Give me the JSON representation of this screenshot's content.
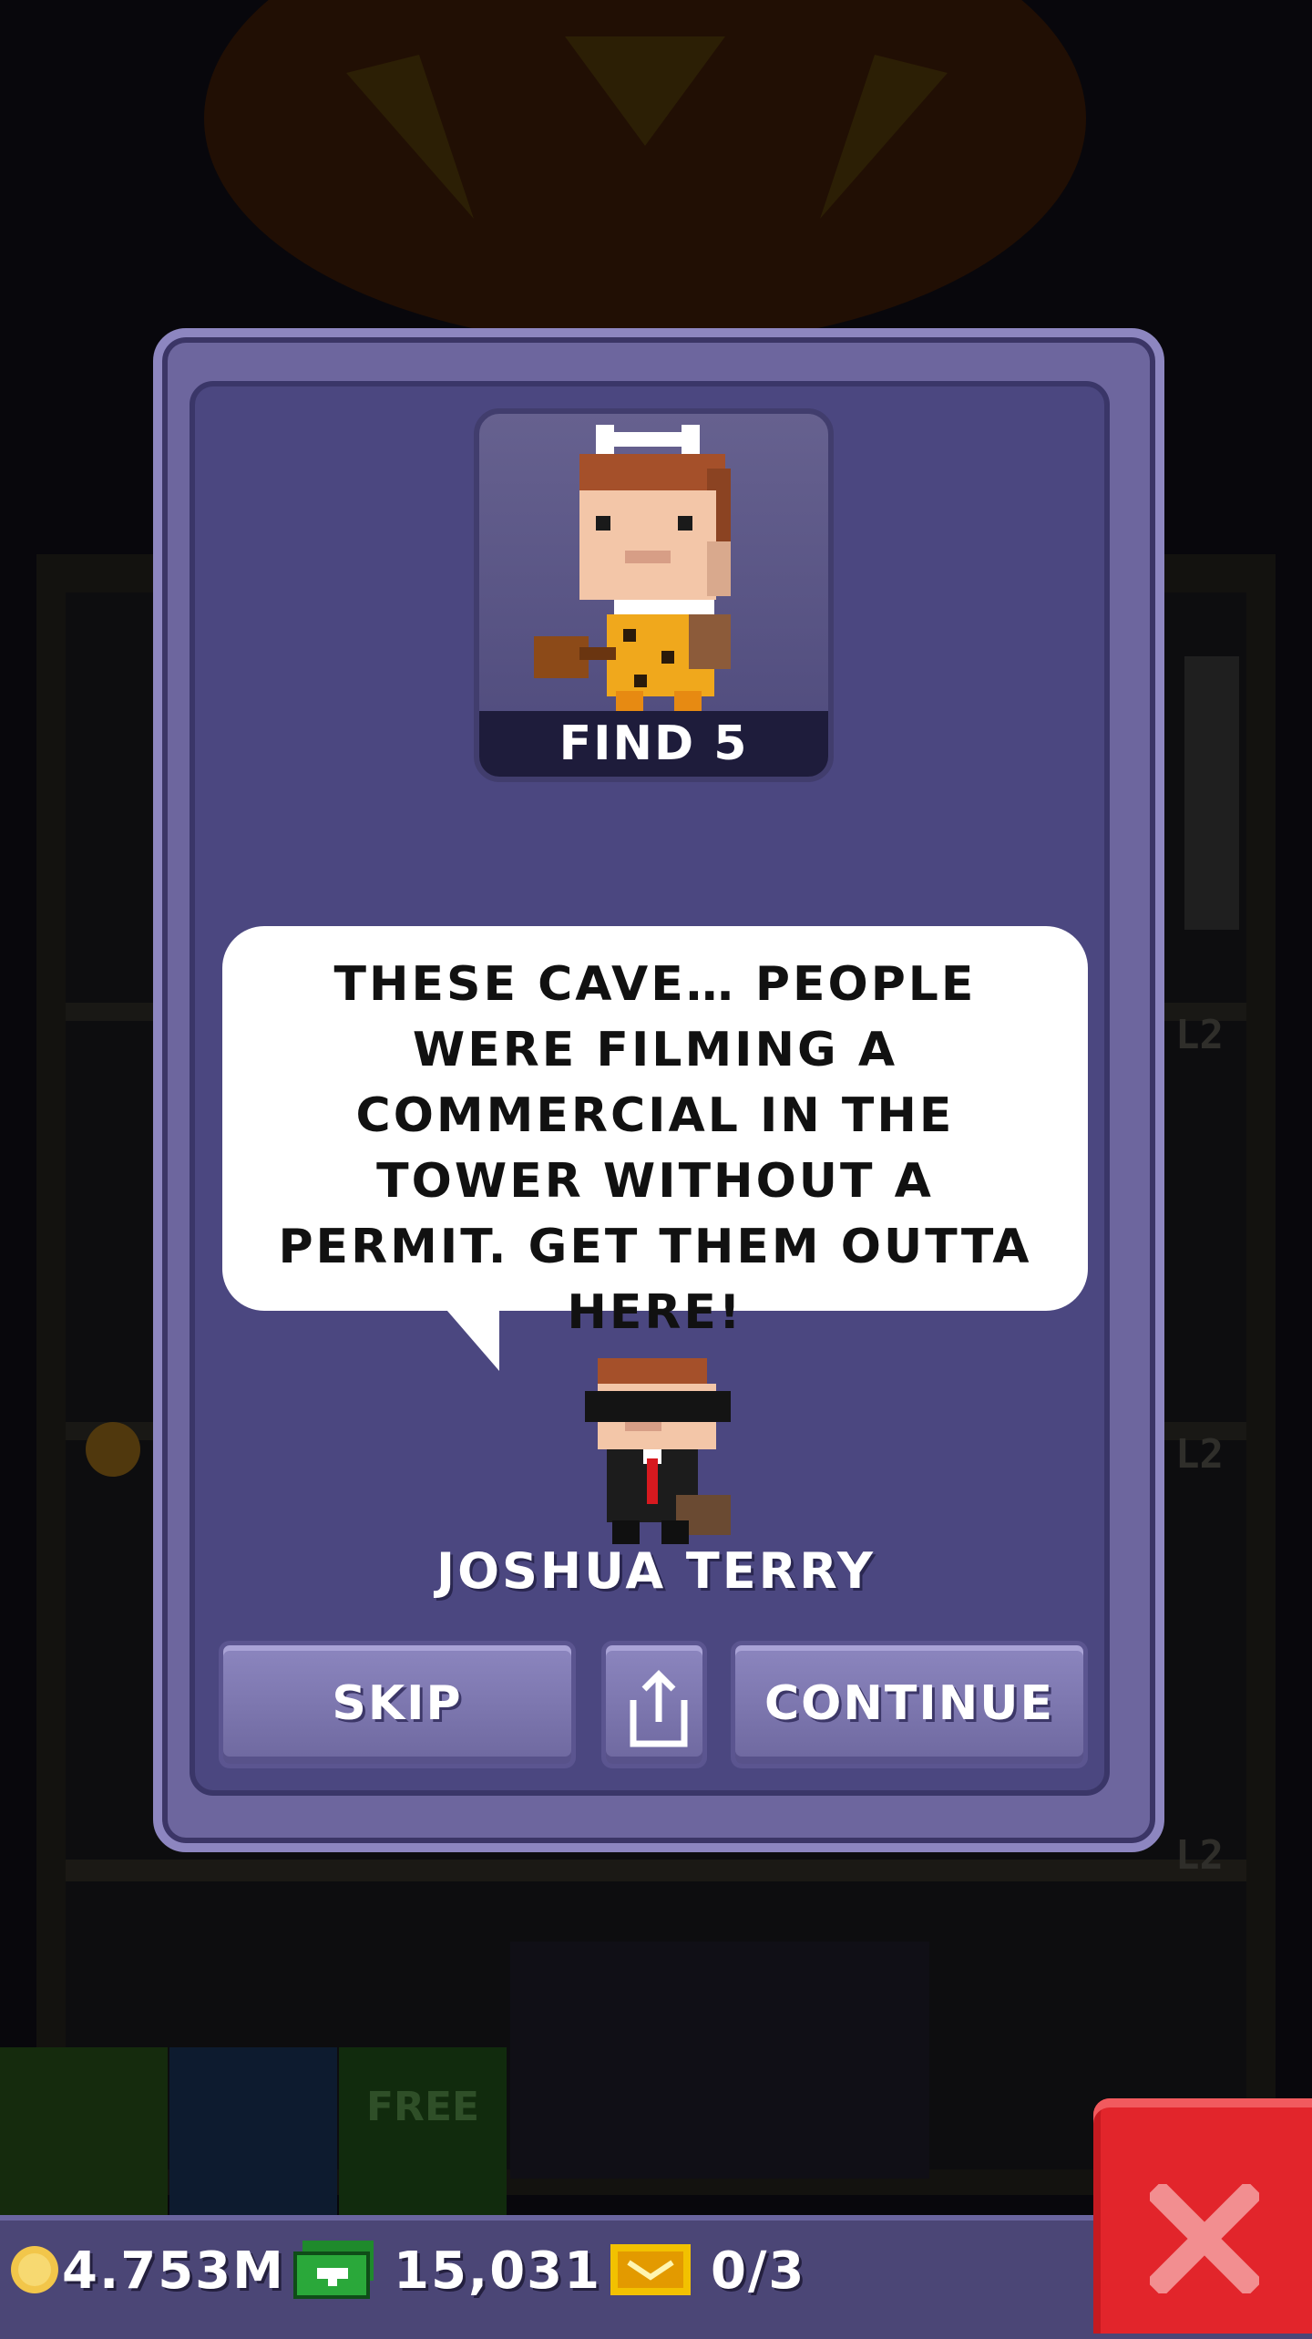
{
  "dialog": {
    "mission_label": "FIND 5",
    "message": "THESE CAVE… PEOPLE WERE FILMING A COMMERCIAL IN THE TOWER WITHOUT A PERMIT. GET THEM OUTTA HERE!",
    "npc_name": "JOSHUA TERRY",
    "buttons": {
      "skip": "SKIP",
      "continue": "CONTINUE"
    }
  },
  "hud": {
    "coins": "4.753M",
    "bux": "15,031",
    "tickets": "0/3"
  },
  "shop": {
    "free_label": "FREE"
  },
  "colors": {
    "modal_outer": "#6d669e",
    "modal_inner": "#4b4780",
    "close_button": "#e2252b",
    "hud_background": "#4b4676"
  },
  "icons": {
    "share": "share-icon",
    "close": "close-icon",
    "coin": "coin-icon",
    "bux": "bux-icon",
    "ticket": "ticket-icon"
  }
}
